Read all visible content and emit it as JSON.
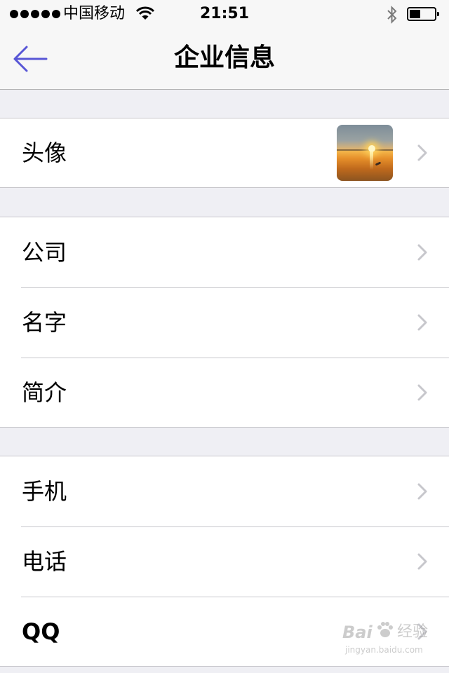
{
  "status_bar": {
    "carrier": "中国移动",
    "time": "21:51",
    "signal_bars": 5,
    "icons": [
      "signal-dots-icon",
      "wifi-icon",
      "bluetooth-icon",
      "battery-icon"
    ],
    "battery_level": 0.45
  },
  "nav": {
    "title": "企业信息",
    "back_icon": "arrow-left-icon",
    "accent_color": "#5856d6"
  },
  "profile_group": {
    "avatar_row_label": "头像",
    "avatar_image": "sunset-over-water-thumbnail"
  },
  "info_group": {
    "rows": [
      {
        "label": "公司"
      },
      {
        "label": "名字"
      },
      {
        "label": "简介"
      }
    ]
  },
  "contact_group": {
    "rows": [
      {
        "label": "手机"
      },
      {
        "label": "电话"
      },
      {
        "label": "QQ"
      }
    ]
  },
  "watermark": {
    "brand": "Bai",
    "suffix": "经验",
    "url": "jingyan.baidu.com"
  },
  "colors": {
    "background": "#efeff4",
    "separator": "#c8c7cc",
    "chevron": "#c7c7cc",
    "bar": "#f7f7f7"
  }
}
